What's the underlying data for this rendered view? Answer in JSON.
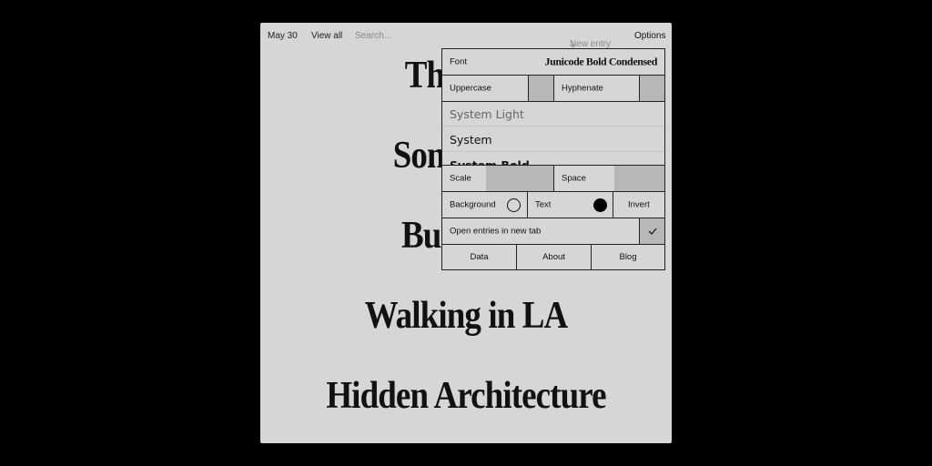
{
  "topbar": {
    "date": "May 30",
    "view_all": "View all",
    "search_placeholder": "Search...",
    "new_entry": "New entry",
    "options": "Options"
  },
  "entries": [
    "The New",
    "Something",
    "Buildings",
    "Walking in LA",
    "Hidden Architecture"
  ],
  "options_panel": {
    "font_label": "Font",
    "font_value": "Junicode Bold Condensed",
    "uppercase_label": "Uppercase",
    "uppercase_on": false,
    "hyphenate_label": "Hyphenate",
    "hyphenate_on": false,
    "font_list": [
      "System Light",
      "System",
      "System Bold"
    ],
    "scale_label": "Scale",
    "space_label": "Space",
    "background_label": "Background",
    "background_color": "#d6d6d6",
    "text_label": "Text",
    "text_color": "#000000",
    "invert_label": "Invert",
    "open_new_tab_label": "Open entries in new tab",
    "open_new_tab_checked": true,
    "links": [
      "Data",
      "About",
      "Blog"
    ]
  }
}
